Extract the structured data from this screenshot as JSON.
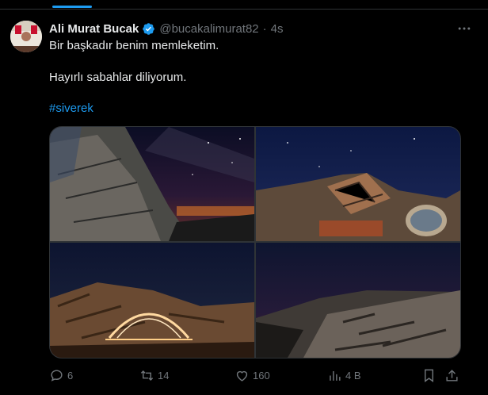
{
  "post": {
    "display_name": "Ali Murat Bucak",
    "handle": "@bucakalimurat82",
    "separator": "·",
    "time": "4s",
    "text_line1": "Bir başkadır benim memleketim.",
    "text_line2": "Hayırlı sabahlar diliyorum.",
    "hashtag": "#siverek"
  },
  "actions": {
    "replies": "6",
    "reposts": "14",
    "likes": "160",
    "views": "4 B"
  },
  "icons": [
    "verified-icon",
    "more-icon",
    "reply-icon",
    "repost-icon",
    "like-icon",
    "views-icon",
    "bookmark-icon",
    "share-icon"
  ],
  "colors": {
    "accent": "#1d9bf0",
    "muted": "#71767b",
    "text": "#e7e9ea",
    "background": "#000000"
  }
}
